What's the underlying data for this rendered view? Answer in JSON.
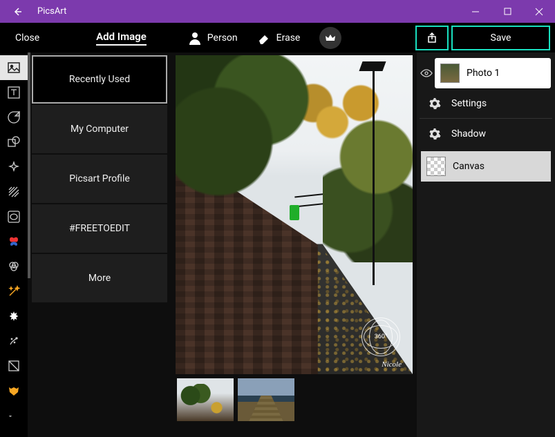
{
  "app": {
    "title": "PicsArt"
  },
  "toolbar": {
    "close": "Close",
    "add_image": "Add Image",
    "person": "Person",
    "erase": "Erase",
    "save": "Save"
  },
  "sources": {
    "items": [
      "Recently Used",
      "My Computer",
      "Picsart Profile",
      "#FREETOEDIT",
      "More"
    ]
  },
  "layers": {
    "photo1": "Photo 1",
    "settings": "Settings",
    "shadow": "Shadow",
    "canvas": "Canvas"
  },
  "overlay": {
    "label360": "360°",
    "signature": "Nicole"
  }
}
